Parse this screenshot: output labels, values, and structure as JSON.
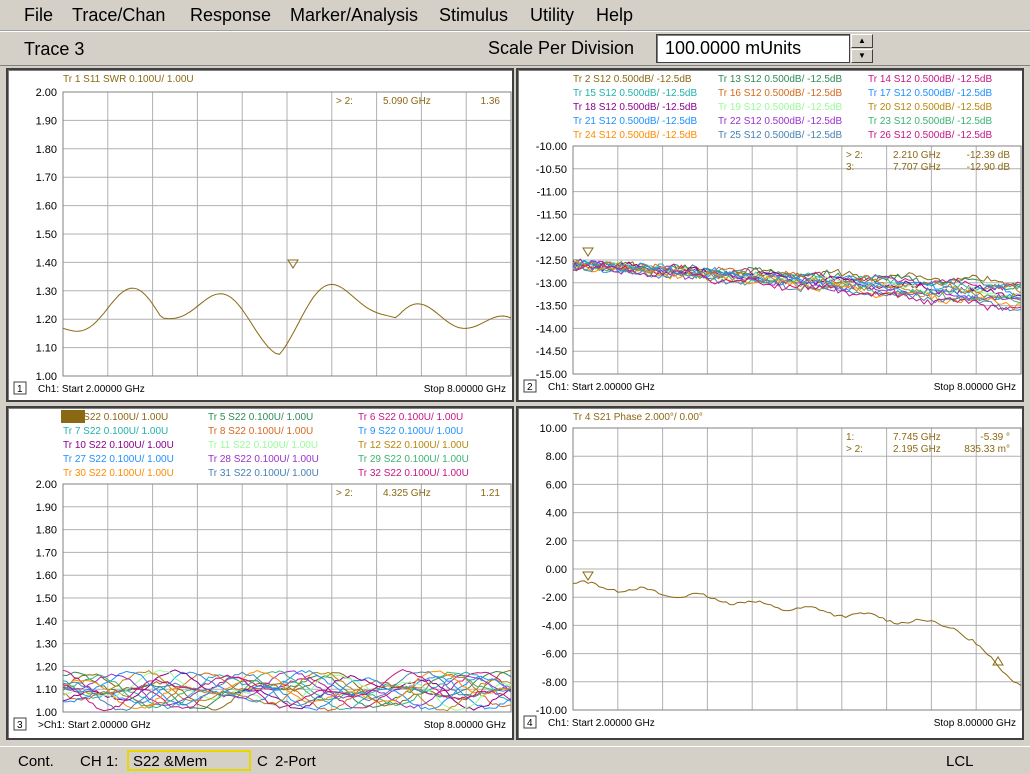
{
  "menu": [
    "File",
    "Trace/Chan",
    "Response",
    "Marker/Analysis",
    "Stimulus",
    "Utility",
    "Help"
  ],
  "toolbar": {
    "trace_title": "Trace 3",
    "scale_label": "Scale Per Division",
    "scale_value": "100.0000 mUnits"
  },
  "status": {
    "mode": "Cont.",
    "channel": "CH 1:",
    "measurement": "S22 &Mem",
    "cal": "C",
    "port": "2-Port",
    "remote": "LCL"
  },
  "colors": {
    "grid": "#b0b0b0",
    "trace_primary": "#8b6914",
    "marker": "#8b6914"
  },
  "panes": [
    {
      "number": "1",
      "trace_legend": [
        "Tr 1  S11 SWR 0.100U/  1.00U"
      ],
      "marker_readouts": [
        {
          "id": "> 2:",
          "freq": "5.090 GHz",
          "value": "1.36"
        }
      ],
      "y_ticks": [
        "2.00",
        "1.90",
        "1.80",
        "1.70",
        "1.60",
        "1.50",
        "1.40",
        "1.30",
        "1.20",
        "1.10",
        "1.00"
      ],
      "start_label": "Ch1: Start  2.00000 GHz",
      "stop_label": "Stop  8.00000 GHz"
    },
    {
      "number": "2",
      "trace_legend": [
        "Tr 2  S12 0.500dB/  -12.5dB",
        "Tr 13  S12 0.500dB/  -12.5dB",
        "Tr 14  S12 0.500dB/  -12.5dB",
        "Tr 15  S12 0.500dB/  -12.5dB",
        "Tr 16  S12 0.500dB/  -12.5dB",
        "Tr 17  S12 0.500dB/  -12.5dB",
        "Tr 18  S12 0.500dB/  -12.5dB",
        "Tr 19  S12 0.500dB/  -12.5dB",
        "Tr 20  S12 0.500dB/  -12.5dB",
        "Tr 21  S12 0.500dB/  -12.5dB",
        "Tr 22  S12 0.500dB/  -12.5dB",
        "Tr 23  S12 0.500dB/  -12.5dB",
        "Tr 24  S12 0.500dB/  -12.5dB",
        "Tr 25  S12 0.500dB/  -12.5dB",
        "Tr 26  S12 0.500dB/  -12.5dB"
      ],
      "marker_readouts": [
        {
          "id": "> 2:",
          "freq": "2.210 GHz",
          "value": "-12.39 dB"
        },
        {
          "id": "3:",
          "freq": "7.707 GHz",
          "value": "-12.90 dB"
        }
      ],
      "y_ticks": [
        "-10.00",
        "-10.50",
        "-11.00",
        "-11.50",
        "-12.00",
        "-12.50",
        "-13.00",
        "-13.50",
        "-14.00",
        "-14.50",
        "-15.00"
      ],
      "start_label": "Ch1: Start  2.00000 GHz",
      "stop_label": "Stop  8.00000 GHz"
    },
    {
      "number": "3",
      "trace_legend": [
        "Tr 3  S22 0.100U/  1.00U",
        "Tr 5  S22 0.100U/  1.00U",
        "Tr 6  S22 0.100U/  1.00U",
        "Tr 7  S22 0.100U/  1.00U",
        "Tr 8  S22 0.100U/  1.00U",
        "Tr 9  S22 0.100U/  1.00U",
        "Tr 10  S22 0.100U/  1.00U",
        "Tr 11  S22 0.100U/  1.00U",
        "Tr 12  S22 0.100U/  1.00U",
        "Tr 27  S22 0.100U/  1.00U",
        "Tr 28  S22 0.100U/  1.00U",
        "Tr 29  S22 0.100U/  1.00U",
        "Tr 30  S22 0.100U/  1.00U",
        "Tr 31  S22 0.100U/  1.00U",
        "Tr 32  S22 0.100U/  1.00U"
      ],
      "marker_readouts": [
        {
          "id": "> 2:",
          "freq": "4.325 GHz",
          "value": "1.21"
        }
      ],
      "y_ticks": [
        "2.00",
        "1.90",
        "1.80",
        "1.70",
        "1.60",
        "1.50",
        "1.40",
        "1.30",
        "1.20",
        "1.10",
        "1.00"
      ],
      "start_label": ">Ch1: Start  2.00000 GHz",
      "stop_label": "Stop  8.00000 GHz"
    },
    {
      "number": "4",
      "trace_legend": [
        "Tr 4  S21 Phase 2.000°/  0.00°"
      ],
      "marker_readouts": [
        {
          "id": "1:",
          "freq": "7.745 GHz",
          "value": "-5.39 °"
        },
        {
          "id": "> 2:",
          "freq": "2.195 GHz",
          "value": "835.33 m°"
        }
      ],
      "y_ticks": [
        "10.00",
        "8.00",
        "6.00",
        "4.00",
        "2.00",
        "0.00",
        "-2.00",
        "-4.00",
        "-6.00",
        "-8.00",
        "-10.00"
      ],
      "start_label": "Ch1: Start  2.00000 GHz",
      "stop_label": "Stop  8.00000 GHz"
    }
  ]
}
